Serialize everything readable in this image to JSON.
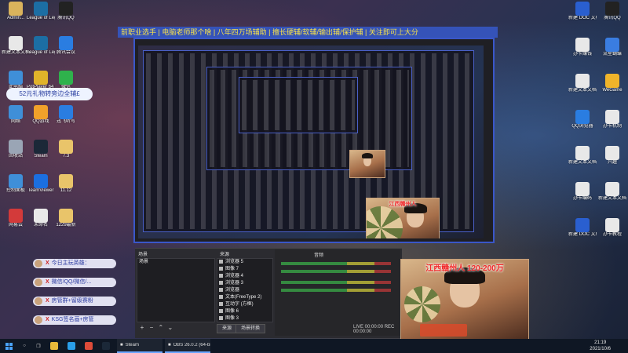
{
  "banner": {
    "text": "前职业选手 | 电脑老师那个啥 | 八年四万场辅助 | 擅长硬辅/软辅/输出辅/保护辅 | 关注即可上大分"
  },
  "gift_note": {
    "text": "52元礼物转旁边全辅£"
  },
  "desktop_icons_left": [
    {
      "label": "Admin...",
      "icon": "user-folder-icon",
      "color": "#d9b35c"
    },
    {
      "label": "League of Legends",
      "icon": "lol-icon",
      "color": "#1c6ea4"
    },
    {
      "label": "腾讯QQ",
      "icon": "qq-icon",
      "color": "#222"
    },
    {
      "label": "新建文本文档",
      "icon": "text-file-icon",
      "color": "#e8e8e8"
    },
    {
      "label": "League of Legends",
      "icon": "lol-icon",
      "color": "#1c6ea4"
    },
    {
      "label": "腾讯会议",
      "icon": "meeting-icon",
      "color": "#2a7de1"
    },
    {
      "label": "此电脑",
      "icon": "computer-icon",
      "color": "#3f8fd8"
    },
    {
      "label": "PotPlayer 64 bit",
      "icon": "potplayer-icon",
      "color": "#e0b32a"
    },
    {
      "label": "微信",
      "icon": "wechat-icon",
      "color": "#2fb24c"
    },
    {
      "label": "网络",
      "icon": "network-icon",
      "color": "#3f8fd8"
    },
    {
      "label": "QQ游戏",
      "icon": "qqgame-icon",
      "color": "#f0a12a"
    },
    {
      "label": "迅飞听写",
      "icon": "voice-icon",
      "color": "#2a7de1"
    },
    {
      "label": "回收站",
      "icon": "recycle-bin-icon",
      "color": "#9aa5b5"
    },
    {
      "label": "Steam",
      "icon": "steam-icon",
      "color": "#1b2838"
    },
    {
      "label": "7.3",
      "icon": "folder-icon",
      "color": "#e9c46a"
    },
    {
      "label": "控制面板",
      "icon": "control-panel-icon",
      "color": "#3f8fd8"
    },
    {
      "label": "TeamViewer",
      "icon": "teamviewer-icon",
      "color": "#1b6fe0"
    },
    {
      "label": "11.12",
      "icon": "folder-icon",
      "color": "#e9c46a"
    },
    {
      "label": "网易云",
      "icon": "music-icon",
      "color": "#d33a3a"
    },
    {
      "label": "未命名",
      "icon": "file-icon",
      "color": "#e8e8e8"
    },
    {
      "label": "1229最新",
      "icon": "folder-icon",
      "color": "#e9c46a"
    }
  ],
  "desktop_icons_right": [
    {
      "label": "新建 DOC 文档",
      "icon": "doc-icon",
      "color": "#2a5fd0"
    },
    {
      "label": "腾讯QQ",
      "icon": "qq-icon",
      "color": "#222"
    },
    {
      "label": "办卡赚钱",
      "icon": "file-icon",
      "color": "#e8e8e8"
    },
    {
      "label": "流星蝴蝶",
      "icon": "app-icon",
      "color": "#3a7de1"
    },
    {
      "label": "新建文本文档",
      "icon": "text-file-icon",
      "color": "#e8e8e8"
    },
    {
      "label": "WeGame",
      "icon": "wegame-icon",
      "color": "#f0b42a"
    },
    {
      "label": "QQ浏览器",
      "icon": "browser-icon",
      "color": "#2a7de1"
    },
    {
      "label": "办卡机制",
      "icon": "file-icon",
      "color": "#e8e8e8"
    },
    {
      "label": "新建文本文档",
      "icon": "text-file-icon",
      "color": "#e8e8e8"
    },
    {
      "label": "兴趣",
      "icon": "file-icon",
      "color": "#e8e8e8"
    },
    {
      "label": "办卡编码",
      "icon": "file-icon",
      "color": "#e8e8e8"
    },
    {
      "label": "新建文本文档",
      "icon": "text-file-icon",
      "color": "#e8e8e8"
    },
    {
      "label": "新建 DOC 文档",
      "icon": "doc-icon",
      "color": "#2a5fd0"
    },
    {
      "label": "办卡教程",
      "icon": "file-icon",
      "color": "#e8e8e8"
    }
  ],
  "webcam_small": {
    "label": "江西赣州人"
  },
  "webcam_big": {
    "label": "江西赣州人 120-200万"
  },
  "obs_dock": {
    "scenes_title": "场景",
    "sources_title": "来源",
    "audio_title": "音频",
    "scene_items": [
      "场景"
    ],
    "sources": [
      "浏览器 5",
      "图像 7",
      "浏览器 4",
      "浏览器 3",
      "浏览器",
      "文本(FreeType 2)",
      "互动字 (方框)",
      "图像 6",
      "图像 3"
    ],
    "tab_scene": "来源",
    "tab_transition": "场景转换",
    "status": "LIVE 00:00:00  REC 00:00:00"
  },
  "chat_messages": [
    {
      "label": "今日主玩英雄：",
      "mark": "X"
    },
    {
      "label": "微信/QQ/微信/...",
      "mark": "X"
    },
    {
      "label": "房管群+留级赛粉",
      "mark": "X"
    },
    {
      "label": "KSG签名画+房管",
      "mark": "X"
    }
  ],
  "taskbar": {
    "apps": [
      {
        "name": "file-explorer-icon",
        "color": "#e8b93a"
      },
      {
        "name": "edge-icon",
        "color": "#2a9ee8"
      },
      {
        "name": "chrome-icon",
        "color": "#dd4b39"
      },
      {
        "name": "steam-icon",
        "color": "#1b2838"
      }
    ],
    "tasks": [
      {
        "label": "Steam",
        "icon": "steam-icon"
      },
      {
        "label": "OBS 26.0.2 (64-bit)",
        "icon": "obs-icon"
      }
    ],
    "time": "21:19",
    "date": "2021/10/6"
  }
}
